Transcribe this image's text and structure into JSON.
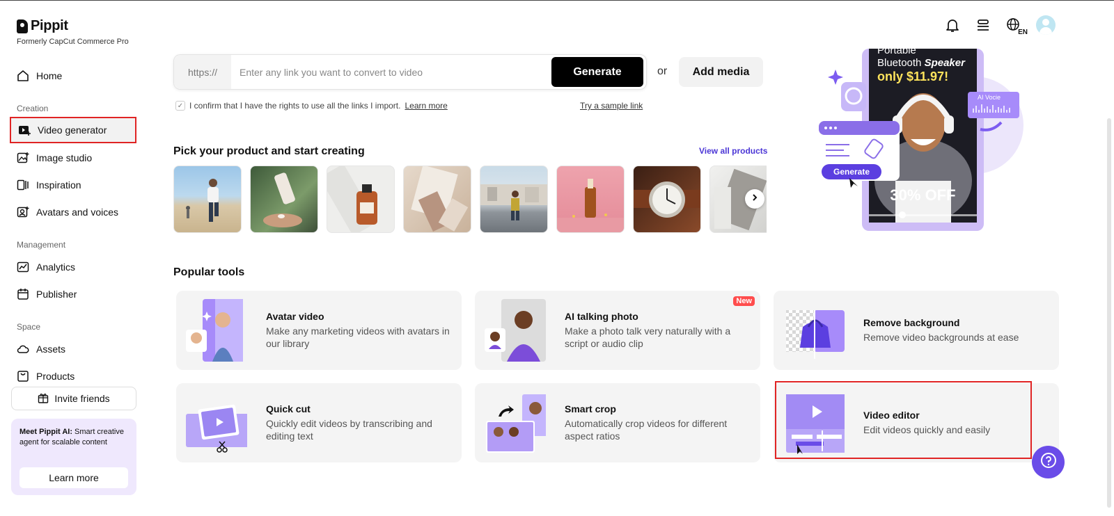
{
  "brand": {
    "name": "Pippit",
    "subtitle": "Formerly CapCut Commerce Pro"
  },
  "sidebar": {
    "home": "Home",
    "creation_label": "Creation",
    "creation": [
      "Video generator",
      "Image studio",
      "Inspiration",
      "Avatars and voices"
    ],
    "management_label": "Management",
    "management": [
      "Analytics",
      "Publisher"
    ],
    "space_label": "Space",
    "space": [
      "Assets",
      "Products"
    ],
    "invite": "Invite friends",
    "promo": {
      "title": "Meet Pippit AI:",
      "text": " Smart creative agent for scalable content",
      "button": "Learn more"
    }
  },
  "header": {
    "lang": "EN"
  },
  "url_bar": {
    "prefix": "https://",
    "placeholder": "Enter any link you want to convert to video",
    "generate": "Generate",
    "or": "or",
    "add_media": "Add media"
  },
  "confirm": {
    "text": "I confirm that I have the rights to use all the links I import.",
    "learn_more": "Learn more",
    "sample": "Try a sample link"
  },
  "products": {
    "title": "Pick your product and start creating",
    "view_all": "View all products"
  },
  "banner": {
    "line1": "Portable",
    "line2a": "Bluetooth ",
    "line2b": "Speaker",
    "price": "only $11.97!",
    "ai_voice": "AI Vocie",
    "generate": "Generate",
    "discount": "30% OFF"
  },
  "tools": {
    "title": "Popular tools",
    "items": [
      {
        "title": "Avatar video",
        "desc": "Make any marketing videos with avatars in our library"
      },
      {
        "title": "AI talking photo",
        "desc": "Make a photo talk very naturally with a script or audio clip",
        "badge": "New"
      },
      {
        "title": "Remove background",
        "desc": "Remove video backgrounds at ease"
      },
      {
        "title": "Quick cut",
        "desc": "Quickly edit videos by transcribing and editing text"
      },
      {
        "title": "Smart crop",
        "desc": "Automatically crop videos for different aspect ratios"
      },
      {
        "title": "Video editor",
        "desc": "Edit videos quickly and easily"
      }
    ]
  },
  "colors": {
    "accent": "#6a4ce8",
    "highlight": "#e02424",
    "link": "#4b36d6"
  }
}
